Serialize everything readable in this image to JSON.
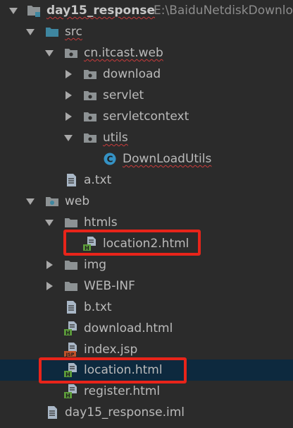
{
  "tree": {
    "root": {
      "label": "day15_response",
      "path": "E:\\BaiduNetdiskDownlo"
    },
    "src": {
      "label": "src"
    },
    "package": {
      "label": "cn.itcast.web"
    },
    "download_pkg": {
      "label": "download"
    },
    "servlet_pkg": {
      "label": "servlet"
    },
    "servletcontext_pkg": {
      "label": "servletcontext"
    },
    "utils_pkg": {
      "label": "utils"
    },
    "downloadutils": {
      "label": "DownLoadUtils"
    },
    "a_txt": {
      "label": "a.txt"
    },
    "web": {
      "label": "web"
    },
    "htmls": {
      "label": "htmls"
    },
    "location2": {
      "label": "location2.html"
    },
    "img": {
      "label": "img"
    },
    "webinf": {
      "label": "WEB-INF"
    },
    "b_txt": {
      "label": "b.txt"
    },
    "download_html": {
      "label": "download.html"
    },
    "index_jsp": {
      "label": "index.jsp"
    },
    "location_html": {
      "label": "location.html"
    },
    "register_html": {
      "label": "register.html"
    },
    "iml": {
      "label": "day15_response.iml"
    }
  },
  "colors": {
    "background": "#2b2b2b",
    "selection": "#0d293e",
    "highlight": "#e8241a",
    "folder": "#8d9294",
    "source_folder": "#3e86a0",
    "html_badge": "#5c9c3a",
    "jsp_badge": "#c0522a",
    "class_icon": "#3592c4"
  },
  "icons": {
    "folder": "folder-icon",
    "package": "package-icon",
    "class": "class-icon",
    "html": "html-file-icon",
    "jsp": "jsp-file-icon",
    "text": "text-file-icon",
    "module": "module-icon"
  }
}
